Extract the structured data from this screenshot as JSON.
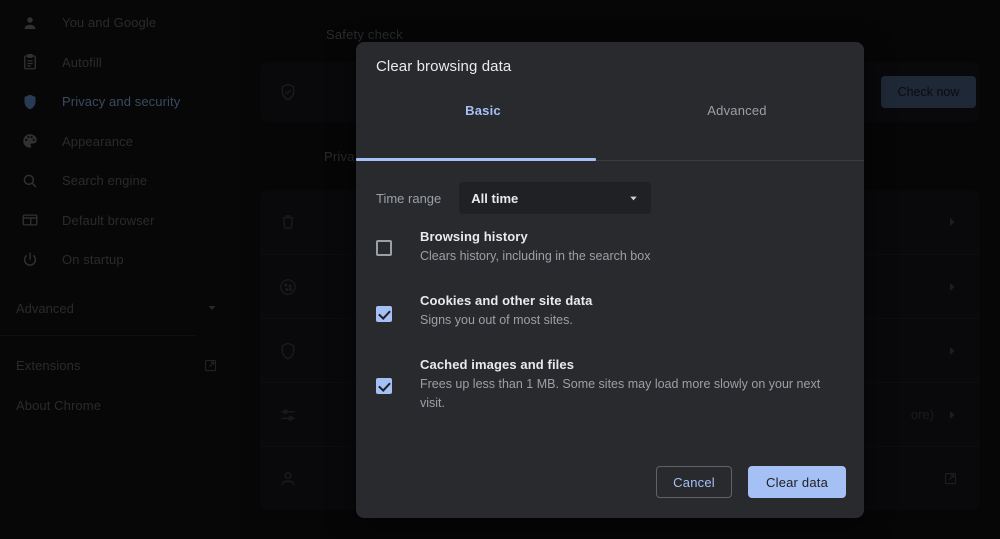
{
  "sidebar": {
    "items": [
      {
        "label": "You and Google",
        "icon": "person-icon",
        "selected": false
      },
      {
        "label": "Autofill",
        "icon": "clipboard-icon",
        "selected": false
      },
      {
        "label": "Privacy and security",
        "icon": "shield-icon",
        "selected": true
      },
      {
        "label": "Appearance",
        "icon": "palette-icon",
        "selected": false
      },
      {
        "label": "Search engine",
        "icon": "search-icon",
        "selected": false
      },
      {
        "label": "Default browser",
        "icon": "browser-window-icon",
        "selected": false
      },
      {
        "label": "On startup",
        "icon": "power-icon",
        "selected": false
      }
    ],
    "advanced": {
      "label": "Advanced",
      "icon": "chevron-down-icon"
    },
    "footer": [
      {
        "label": "Extensions",
        "icon": "open-in-new-icon"
      },
      {
        "label": "About Chrome",
        "icon": ""
      }
    ]
  },
  "main": {
    "safety_check_heading": "Safety check",
    "check_now_label": "Check now",
    "privacy_heading": "Priva",
    "trailing_text": "ore)",
    "rows": [
      {
        "icon": "trash-icon"
      },
      {
        "icon": "cookie-icon"
      },
      {
        "icon": "shield-icon"
      },
      {
        "icon": "sliders-icon"
      },
      {
        "icon": "person-icon"
      }
    ]
  },
  "dialog": {
    "title": "Clear browsing data",
    "tabs": [
      {
        "label": "Basic",
        "active": true
      },
      {
        "label": "Advanced",
        "active": false
      }
    ],
    "time_range": {
      "label": "Time range",
      "value": "All time",
      "caret_icon": "chevron-down-icon"
    },
    "options": [
      {
        "title": "Browsing history",
        "description": "Clears history, including in the search box",
        "checked": false
      },
      {
        "title": "Cookies and other site data",
        "description": "Signs you out of most sites.",
        "checked": true
      },
      {
        "title": "Cached images and files",
        "description": "Frees up less than 1 MB. Some sites may load more slowly on your next visit.",
        "checked": true
      }
    ],
    "cancel_label": "Cancel",
    "confirm_label": "Clear data"
  },
  "colors": {
    "accent_blue": "#a4c0f4",
    "dialog_bg": "#292a2d",
    "page_bg": "#0b0b0c",
    "select_bg": "#202124",
    "muted_text": "#9aa0a6",
    "primary_text": "#e8eaed"
  }
}
